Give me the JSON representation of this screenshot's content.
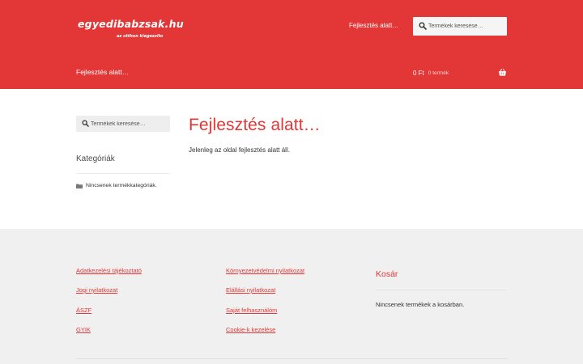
{
  "header": {
    "logo_main": "egyedibabzsak.hu",
    "logo_sub": "az otthon kiegeszito",
    "top_nav_item": "Fejlesztés alatt…",
    "search_placeholder": "Termékek keresése…",
    "primary_nav_item": "Fejlesztés alatt…",
    "cart_amount": "0 Ft",
    "cart_count": "0 termék"
  },
  "sidebar": {
    "search_placeholder": "Termékek keresése…",
    "widget_title": "Kategóriák",
    "no_categories": "Nincsenek termékkategóriák."
  },
  "main": {
    "title": "Fejlesztés alatt…",
    "text": "Jelenleg az oldal fejlesztés alatt áll."
  },
  "footer": {
    "col1": [
      "Adatkezelési tájékoztató",
      "Jogi nyilatkozat",
      "ÁSZF",
      "GYIK"
    ],
    "col2": [
      "Környezetvédelmi nyilatkozat",
      "Elállási nyilatkozat",
      "Saját felhasználóm",
      "Cookie-k kezelése"
    ],
    "cart_title": "Kosár",
    "cart_empty": "Nincsenek termékek a kosárban."
  },
  "colors": {
    "brand_red": "#e33636",
    "footer_bg": "#f0f0f0"
  },
  "icons": {
    "search": "search-icon",
    "cart": "basket-icon",
    "folder": "folder-icon"
  }
}
